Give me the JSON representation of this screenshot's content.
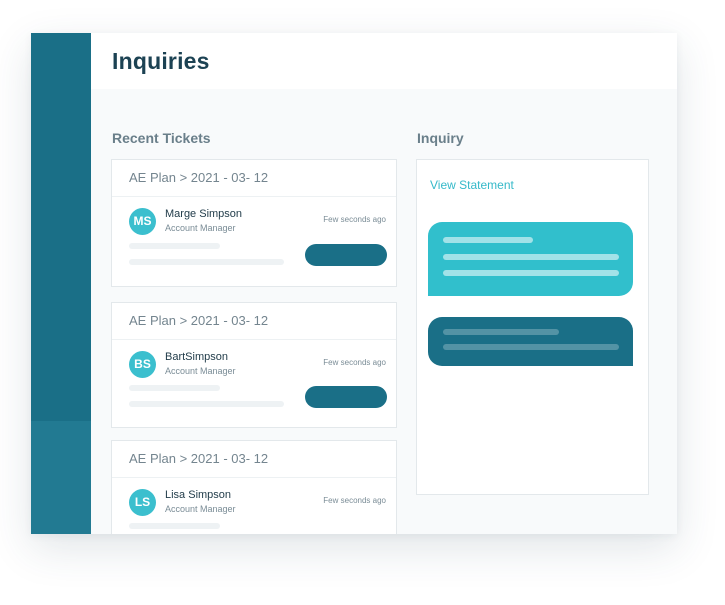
{
  "header": {
    "title": "Inquiries"
  },
  "recent_tickets": {
    "title": "Recent Tickets",
    "items": [
      {
        "plan": "AE Plan > 2021 - 03- 12",
        "initials": "MS",
        "name": "Marge Simpson",
        "role": "Account Manager",
        "time": "Few seconds ago"
      },
      {
        "plan": "AE Plan > 2021 - 03- 12",
        "initials": "BS",
        "name": "BartSimpson",
        "role": "Account Manager",
        "time": "Few seconds ago"
      },
      {
        "plan": "AE Plan > 2021 - 03- 12",
        "initials": "LS",
        "name": "Lisa Simpson",
        "role": "Account Manager",
        "time": "Few seconds ago"
      }
    ]
  },
  "inquiry": {
    "title": "Inquiry",
    "link": "View Statement"
  },
  "colors": {
    "sidebar": "#1a6f87",
    "accent_teal": "#31bfcc",
    "accent_dark": "#1a6f87",
    "title_text": "#1c4253"
  }
}
